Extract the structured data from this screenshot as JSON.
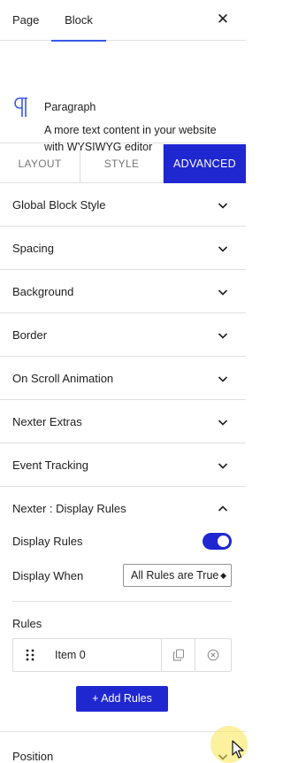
{
  "tabs": {
    "page": "Page",
    "block": "Block"
  },
  "block": {
    "title": "Paragraph",
    "description": "A more text content in your website with WYSIWYG editor"
  },
  "segment": {
    "layout": "LAYOUT",
    "style": "STYLE",
    "advanced": "ADVANCED"
  },
  "panels": [
    "Global Block Style",
    "Spacing",
    "Background",
    "Border",
    "On Scroll Animation",
    "Nexter Extras",
    "Event Tracking",
    "Nexter : Display Rules",
    "Position"
  ],
  "display_rules": {
    "toggle_label": "Display Rules",
    "toggle_on": true,
    "when_label": "Display When",
    "when_value": "All Rules are True",
    "rules_label": "Rules",
    "rules": [
      {
        "name": "Item 0"
      }
    ],
    "add_button": "+ Add Rules"
  },
  "colors": {
    "accent": "#1f27d1",
    "tab_underline": "#3858e9"
  },
  "icons": [
    "paragraph-icon",
    "close-icon",
    "chevron-down-icon",
    "chevron-up-icon",
    "drag-handle-icon",
    "copy-icon",
    "remove-icon",
    "cursor-icon"
  ]
}
